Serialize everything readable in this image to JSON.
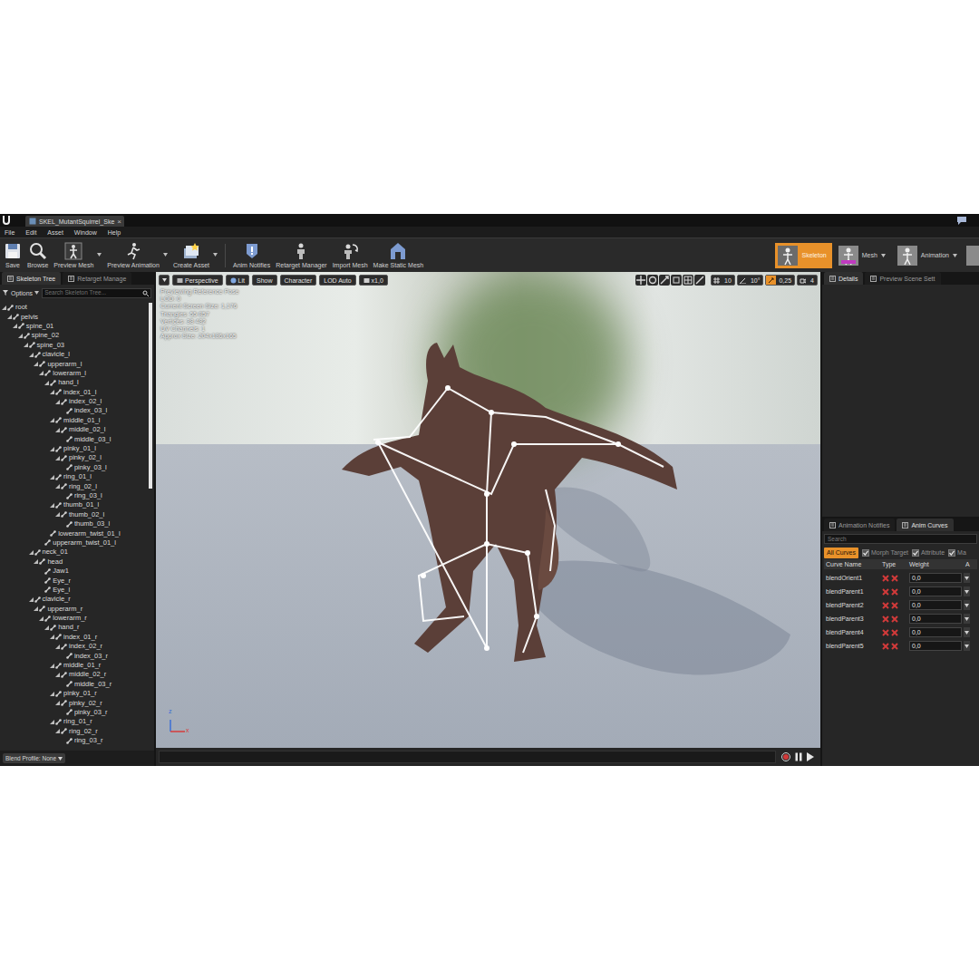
{
  "document_tab": {
    "title": "SKEL_MutantSquirrel_Ske",
    "close": "×"
  },
  "menu": [
    "File",
    "Edit",
    "Asset",
    "Window",
    "Help"
  ],
  "toolbar": [
    {
      "label": "Save",
      "dropdown": false
    },
    {
      "label": "Browse",
      "dropdown": false
    },
    {
      "label": "Preview Mesh",
      "dropdown": true
    },
    {
      "label": "Preview Animation",
      "dropdown": true
    },
    {
      "label": "Create Asset",
      "dropdown": true
    },
    {
      "label": "Anim Notifies",
      "dropdown": false
    },
    {
      "label": "Retarget Manager",
      "dropdown": false
    },
    {
      "label": "Import Mesh",
      "dropdown": false
    },
    {
      "label": "Make Static Mesh",
      "dropdown": false
    }
  ],
  "modes": [
    {
      "label": "Skeleton",
      "selected": true,
      "dropdown": false
    },
    {
      "label": "Mesh",
      "selected": false,
      "dropdown": true
    },
    {
      "label": "Animation",
      "selected": false,
      "dropdown": true
    }
  ],
  "skeleton_panel": {
    "tabs": [
      {
        "label": "Skeleton Tree",
        "selected": true
      },
      {
        "label": "Retarget Manage",
        "selected": false
      }
    ],
    "options": "Options",
    "search_placeholder": "Search Skeleton Tree...",
    "bones": [
      {
        "name": "root",
        "depth": 0,
        "expanded": true
      },
      {
        "name": "pelvis",
        "depth": 1,
        "expanded": true
      },
      {
        "name": "spine_01",
        "depth": 2,
        "expanded": true
      },
      {
        "name": "spine_02",
        "depth": 3,
        "expanded": true
      },
      {
        "name": "spine_03",
        "depth": 4,
        "expanded": true
      },
      {
        "name": "clavicle_l",
        "depth": 5,
        "expanded": true
      },
      {
        "name": "upperarm_l",
        "depth": 6,
        "expanded": true
      },
      {
        "name": "lowerarm_l",
        "depth": 7,
        "expanded": true
      },
      {
        "name": "hand_l",
        "depth": 8,
        "expanded": true
      },
      {
        "name": "index_01_l",
        "depth": 9,
        "expanded": true
      },
      {
        "name": "index_02_l",
        "depth": 10,
        "expanded": true
      },
      {
        "name": "index_03_l",
        "depth": 11,
        "expanded": false
      },
      {
        "name": "middle_01_l",
        "depth": 9,
        "expanded": true
      },
      {
        "name": "middle_02_l",
        "depth": 10,
        "expanded": true
      },
      {
        "name": "middle_03_l",
        "depth": 11,
        "expanded": false
      },
      {
        "name": "pinky_01_l",
        "depth": 9,
        "expanded": true
      },
      {
        "name": "pinky_02_l",
        "depth": 10,
        "expanded": true
      },
      {
        "name": "pinky_03_l",
        "depth": 11,
        "expanded": false
      },
      {
        "name": "ring_01_l",
        "depth": 9,
        "expanded": true
      },
      {
        "name": "ring_02_l",
        "depth": 10,
        "expanded": true
      },
      {
        "name": "ring_03_l",
        "depth": 11,
        "expanded": false
      },
      {
        "name": "thumb_01_l",
        "depth": 9,
        "expanded": true
      },
      {
        "name": "thumb_02_l",
        "depth": 10,
        "expanded": true
      },
      {
        "name": "thumb_03_l",
        "depth": 11,
        "expanded": false
      },
      {
        "name": "lowerarm_twist_01_l",
        "depth": 8,
        "expanded": false
      },
      {
        "name": "upperarm_twist_01_l",
        "depth": 7,
        "expanded": false
      },
      {
        "name": "neck_01",
        "depth": 5,
        "expanded": true
      },
      {
        "name": "head",
        "depth": 6,
        "expanded": true
      },
      {
        "name": "Jaw1",
        "depth": 7,
        "expanded": false
      },
      {
        "name": "Eye_r",
        "depth": 7,
        "expanded": false
      },
      {
        "name": "Eye_l",
        "depth": 7,
        "expanded": false
      },
      {
        "name": "clavicle_r",
        "depth": 5,
        "expanded": true
      },
      {
        "name": "upperarm_r",
        "depth": 6,
        "expanded": true
      },
      {
        "name": "lowerarm_r",
        "depth": 7,
        "expanded": true
      },
      {
        "name": "hand_r",
        "depth": 8,
        "expanded": true
      },
      {
        "name": "index_01_r",
        "depth": 9,
        "expanded": true
      },
      {
        "name": "index_02_r",
        "depth": 10,
        "expanded": true
      },
      {
        "name": "index_03_r",
        "depth": 11,
        "expanded": false
      },
      {
        "name": "middle_01_r",
        "depth": 9,
        "expanded": true
      },
      {
        "name": "middle_02_r",
        "depth": 10,
        "expanded": true
      },
      {
        "name": "middle_03_r",
        "depth": 11,
        "expanded": false
      },
      {
        "name": "pinky_01_r",
        "depth": 9,
        "expanded": true
      },
      {
        "name": "pinky_02_r",
        "depth": 10,
        "expanded": true
      },
      {
        "name": "pinky_03_r",
        "depth": 11,
        "expanded": false
      },
      {
        "name": "ring_01_r",
        "depth": 9,
        "expanded": true
      },
      {
        "name": "ring_02_r",
        "depth": 10,
        "expanded": true
      },
      {
        "name": "ring_03_r",
        "depth": 11,
        "expanded": false
      }
    ],
    "blend_profile": "Blend Profile: None"
  },
  "viewport": {
    "buttons": [
      "Perspective",
      "Lit",
      "Show",
      "Character",
      "LOD Auto",
      "x1,0"
    ],
    "snaps": [
      {
        "value": "10",
        "enabled": false
      },
      {
        "value": "10°",
        "enabled": false
      },
      {
        "value": "0,25",
        "enabled": true
      },
      {
        "value": "4",
        "enabled": false
      }
    ],
    "info": [
      "Previewing Reference Pose",
      "LOD: 0",
      "Current Screen Size: 1,176",
      "Triangles: 55 857",
      "Vertices: 38 482",
      "UV Channels: 1",
      "Approx Size: 204x186x165"
    ],
    "axes": [
      "z",
      "x"
    ]
  },
  "details_panel": {
    "tabs": [
      {
        "label": "Details",
        "selected": true
      },
      {
        "label": "Preview Scene Sett",
        "selected": false
      }
    ]
  },
  "curves_panel": {
    "tabs": [
      {
        "label": "Animation Notifies",
        "selected": false
      },
      {
        "label": "Anim Curves",
        "selected": true
      }
    ],
    "search_placeholder": "Search",
    "filters": [
      {
        "label": "All Curves",
        "kind": "button",
        "selected": true,
        "checked": false
      },
      {
        "label": "Morph Target",
        "kind": "checkbox",
        "selected": false,
        "checked": true
      },
      {
        "label": "Attribute",
        "kind": "checkbox",
        "selected": false,
        "checked": true
      },
      {
        "label": "Ma",
        "kind": "checkbox",
        "selected": false,
        "checked": true
      }
    ],
    "columns": [
      "Curve Name",
      "Type",
      "Weight",
      "A"
    ],
    "rows": [
      {
        "name": "blendOrient1",
        "weight": "0,0",
        "level": 0
      },
      {
        "name": "blendParent1",
        "weight": "0,0",
        "level": 0
      },
      {
        "name": "blendParent2",
        "weight": "0,0",
        "level": 0
      },
      {
        "name": "blendParent3",
        "weight": "0,0",
        "level": 0
      },
      {
        "name": "blendParent4",
        "weight": "0,0",
        "level": 0
      },
      {
        "name": "blendParent5",
        "weight": "0,0",
        "level": 0
      }
    ]
  }
}
